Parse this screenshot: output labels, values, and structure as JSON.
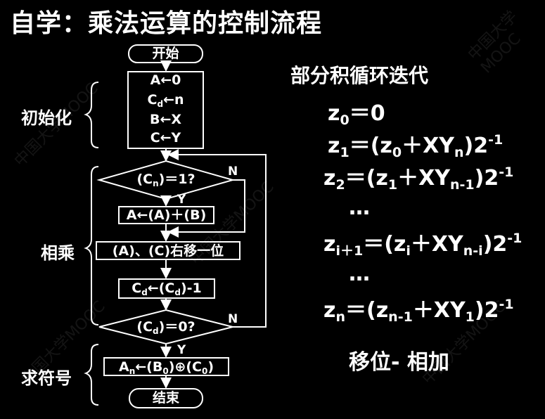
{
  "title": "自学：乘法运算的控制流程",
  "side_labels": {
    "init": "初始化",
    "multiply": "相乘",
    "sign": "求符号"
  },
  "flow": {
    "start": "开始",
    "init_lines": {
      "a": "A←0",
      "c_pre": "C",
      "c_sub": "d",
      "c_post": "←n",
      "b": "B←X",
      "c": "C←Y"
    },
    "cond1": {
      "pre": "(C",
      "sub": "n",
      "post": ")＝1?"
    },
    "add": "A←(A)＋(B)",
    "shift": "(A)、(C)右移一位",
    "dec": {
      "pre": "C",
      "sub": "d",
      "mid": "←(C",
      "sub2": "d",
      "post": ")-1"
    },
    "cond2": {
      "pre": "(C",
      "sub": "d",
      "post": ")＝0?"
    },
    "sign": {
      "pre": "A",
      "sub": "n",
      "mid": "←(B",
      "sub2": "0",
      "mid2": ")⊕(C",
      "sub3": "0",
      "post": ")"
    },
    "end": "结束",
    "yes": "Y",
    "no": "N"
  },
  "right": {
    "heading": "部分积循环迭代",
    "eq0": {
      "a": "z",
      "a_sub": "0",
      "rest": "＝0"
    },
    "eq1": {
      "a": "z",
      "a_sub": "1",
      "b": "＝(z",
      "b_sub": "0",
      "c": "＋XY",
      "c_sub": "n",
      "d": ")2",
      "sup": "-1"
    },
    "eq2": {
      "a": "z",
      "a_sub": "2",
      "b": "＝(z",
      "b_sub": "1",
      "c": "＋XY",
      "c_sub": "n-1",
      "d": ")2",
      "sup": "-1"
    },
    "dots1": "…",
    "eqi": {
      "a": "z",
      "a_sub": "i＋1",
      "b": "＝(z",
      "b_sub": "i",
      "c": "＋XY",
      "c_sub": "n-i",
      "d": ")2",
      "sup": "-1"
    },
    "dots2": "…",
    "eqn": {
      "a": "z",
      "a_sub": "n",
      "b": "＝(z",
      "b_sub": "n-1",
      "c": "＋XY",
      "c_sub": "1",
      "d": ")2",
      "sup": "-1"
    },
    "footer": "移位- 相加"
  },
  "watermark": "中国大学MOOC",
  "colors": {
    "background": "#000000",
    "foreground": "#ffffff"
  }
}
